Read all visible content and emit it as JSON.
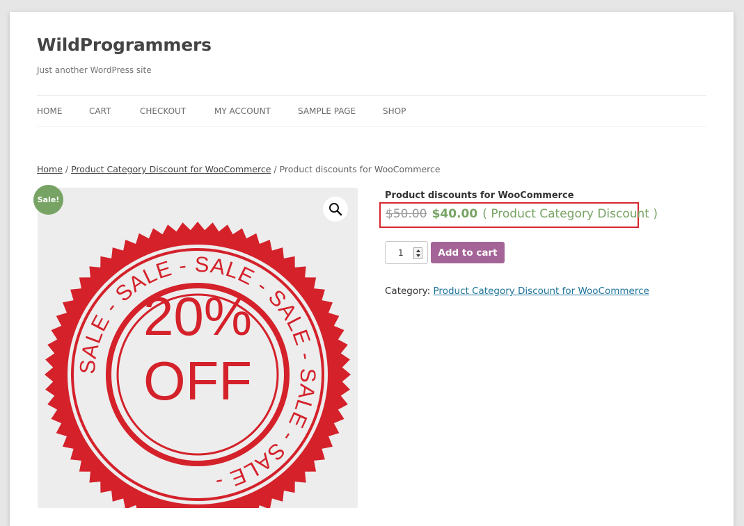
{
  "site": {
    "title": "WildProgrammers",
    "tagline": "Just another WordPress site"
  },
  "nav": {
    "items": [
      "HOME",
      "CART",
      "CHECKOUT",
      "MY ACCOUNT",
      "SAMPLE PAGE",
      "SHOP"
    ]
  },
  "breadcrumb": {
    "home": "Home",
    "sep": " / ",
    "category": "Product Category Discount for WooCommerce",
    "current": "Product discounts for WooCommerce"
  },
  "product": {
    "sale_badge": "Sale!",
    "title": "Product discounts for WooCommerce",
    "old_price": "$50.00",
    "new_price": "$40.00",
    "discount_label": "( Product Category Discount )",
    "quantity": "1",
    "add_to_cart": "Add to cart",
    "category_label": "Category:",
    "category_link": "Product Category Discount for WooCommerce",
    "image_text": {
      "percent": "20%",
      "off": "OFF",
      "ring": "SALE - SALE - SALE - SALE - SALE - SALE - "
    }
  },
  "colors": {
    "sale_green": "#77a464",
    "button_purple": "#a46497",
    "stamp_red": "#d4212a",
    "highlight_red": "#d6262e"
  },
  "icons": {
    "zoom": "magnifier-icon"
  }
}
